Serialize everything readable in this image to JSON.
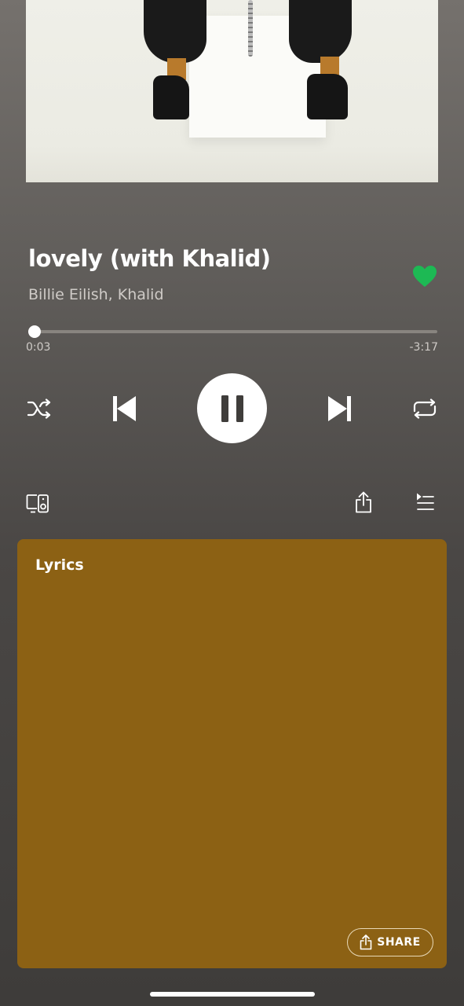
{
  "track": {
    "title": "lovely (with Khalid)",
    "artists": "Billie Eilish, Khalid",
    "liked": true
  },
  "playback": {
    "elapsed": "0:03",
    "remaining": "-3:17",
    "progress": 0.015,
    "state": "playing",
    "shuffle": false,
    "repeat": false
  },
  "controls": {
    "shuffle_icon": "shuffle-icon",
    "previous_icon": "skip-previous-icon",
    "pause_icon": "pause-icon",
    "next_icon": "skip-next-icon",
    "repeat_icon": "repeat-icon",
    "devices_icon": "devices-icon",
    "share_icon": "share-icon",
    "queue_icon": "queue-icon"
  },
  "lyrics": {
    "heading": "Lyrics",
    "share_label": "SHARE"
  },
  "colors": {
    "accent_green": "#1db954",
    "lyrics_card": "#8c6114",
    "background_top": "#75716d",
    "background_bottom": "#3e3c3a"
  }
}
